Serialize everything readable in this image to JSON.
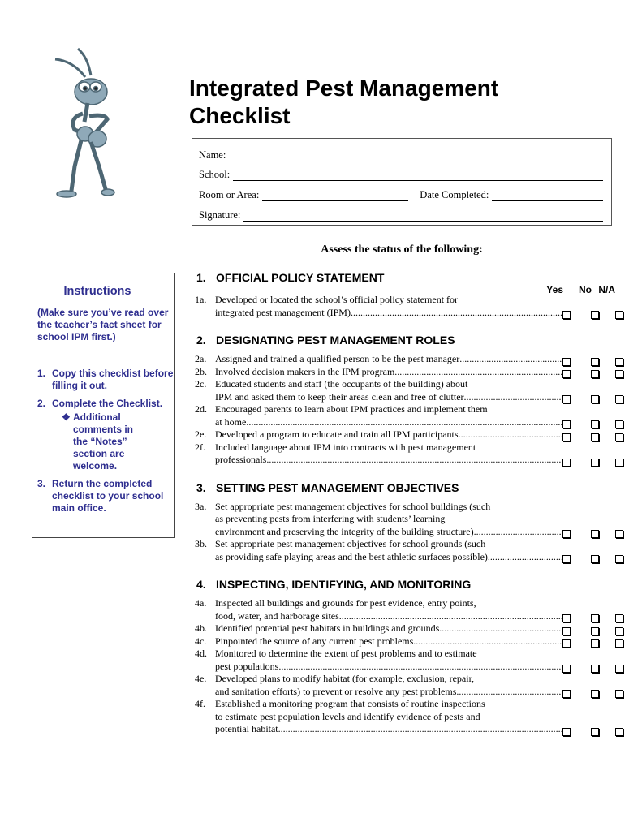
{
  "title_line1": "Integrated Pest Management",
  "title_line2": "Checklist",
  "mascot": "ant-mascot-image",
  "form": {
    "name_label": "Name:",
    "school_label": "School:",
    "room_label": "Room or Area:",
    "date_label": "Date Completed:",
    "signature_label": "Signature:"
  },
  "assess_heading": "Assess the status of the following:",
  "columns": {
    "yes": "Yes",
    "no": "No",
    "na": "N/A"
  },
  "instructions": {
    "heading": "Instructions",
    "intro": "(Make sure you’ve read over the teacher’s fact sheet for school IPM first.)",
    "steps": [
      {
        "num": "1.",
        "text": "Copy this checklist before filling it out."
      },
      {
        "num": "2.",
        "text": "Complete the Checklist."
      },
      {
        "num": "3.",
        "text": "Return the completed checklist to your school main office."
      }
    ],
    "sub_bullet": "❖",
    "sub_text": "Additional comments in the “Notes” section are welcome."
  },
  "sections": [
    {
      "num": "1.",
      "title": "OFFICIAL POLICY STATEMENT",
      "items": [
        {
          "id": "1a.",
          "lines": [
            "Developed or located the school’s official policy statement for"
          ],
          "last": "integrated pest management (IPM)"
        }
      ]
    },
    {
      "num": "2.",
      "title": "DESIGNATING PEST MANAGEMENT ROLES",
      "items": [
        {
          "id": "2a.",
          "lines": [],
          "last": "Assigned and trained a qualified person to be the pest manager "
        },
        {
          "id": "2b.",
          "lines": [],
          "last": "Involved decision makers in the IPM program"
        },
        {
          "id": "2c.",
          "lines": [
            "Educated students and staff (the occupants of the building) about"
          ],
          "last": "IPM and asked them to keep their areas clean and free of clutter"
        },
        {
          "id": "2d.",
          "lines": [
            "Encouraged parents to learn about IPM practices and implement them"
          ],
          "last": "at home "
        },
        {
          "id": "2e.",
          "lines": [],
          "last": "Developed a program to educate and train all IPM participants "
        },
        {
          "id": "2f.",
          "lines": [
            "Included language about IPM into contracts with pest management"
          ],
          "last": "professionals "
        }
      ]
    },
    {
      "num": "3.",
      "title": "SETTING PEST MANAGEMENT OBJECTIVES",
      "items": [
        {
          "id": "3a.",
          "lines": [
            "Set appropriate pest management objectives for school buildings (such",
            "as preventing pests from interfering with students’ learning"
          ],
          "last": "environment and preserving the integrity of the building structure)"
        },
        {
          "id": "3b.",
          "lines": [
            "Set appropriate pest management objectives for school grounds (such"
          ],
          "last": "as providing safe playing areas and the best athletic surfaces possible) "
        }
      ]
    },
    {
      "num": "4.",
      "title": "INSPECTING, IDENTIFYING, AND MONITORING",
      "items": [
        {
          "id": "4a.",
          "lines": [
            "Inspected all buildings and grounds for pest evidence, entry points,"
          ],
          "last": "food, water, and harborage sites "
        },
        {
          "id": "4b.",
          "lines": [],
          "last": "Identified potential pest habitats in buildings and grounds"
        },
        {
          "id": "4c.",
          "lines": [],
          "last": "Pinpointed the source of any current pest problems "
        },
        {
          "id": "4d.",
          "lines": [
            "Monitored to determine the extent of pest problems and to estimate"
          ],
          "last": "pest populations "
        },
        {
          "id": "4e.",
          "lines": [
            "Developed plans to modify habitat (for example, exclusion, repair,"
          ],
          "last": "and sanitation efforts) to prevent or resolve any pest problems"
        },
        {
          "id": "4f.",
          "lines": [
            "Established a monitoring program that consists of routine inspections",
            "to estimate pest population levels and identify evidence of pests and"
          ],
          "last": "potential habitat "
        }
      ]
    }
  ]
}
